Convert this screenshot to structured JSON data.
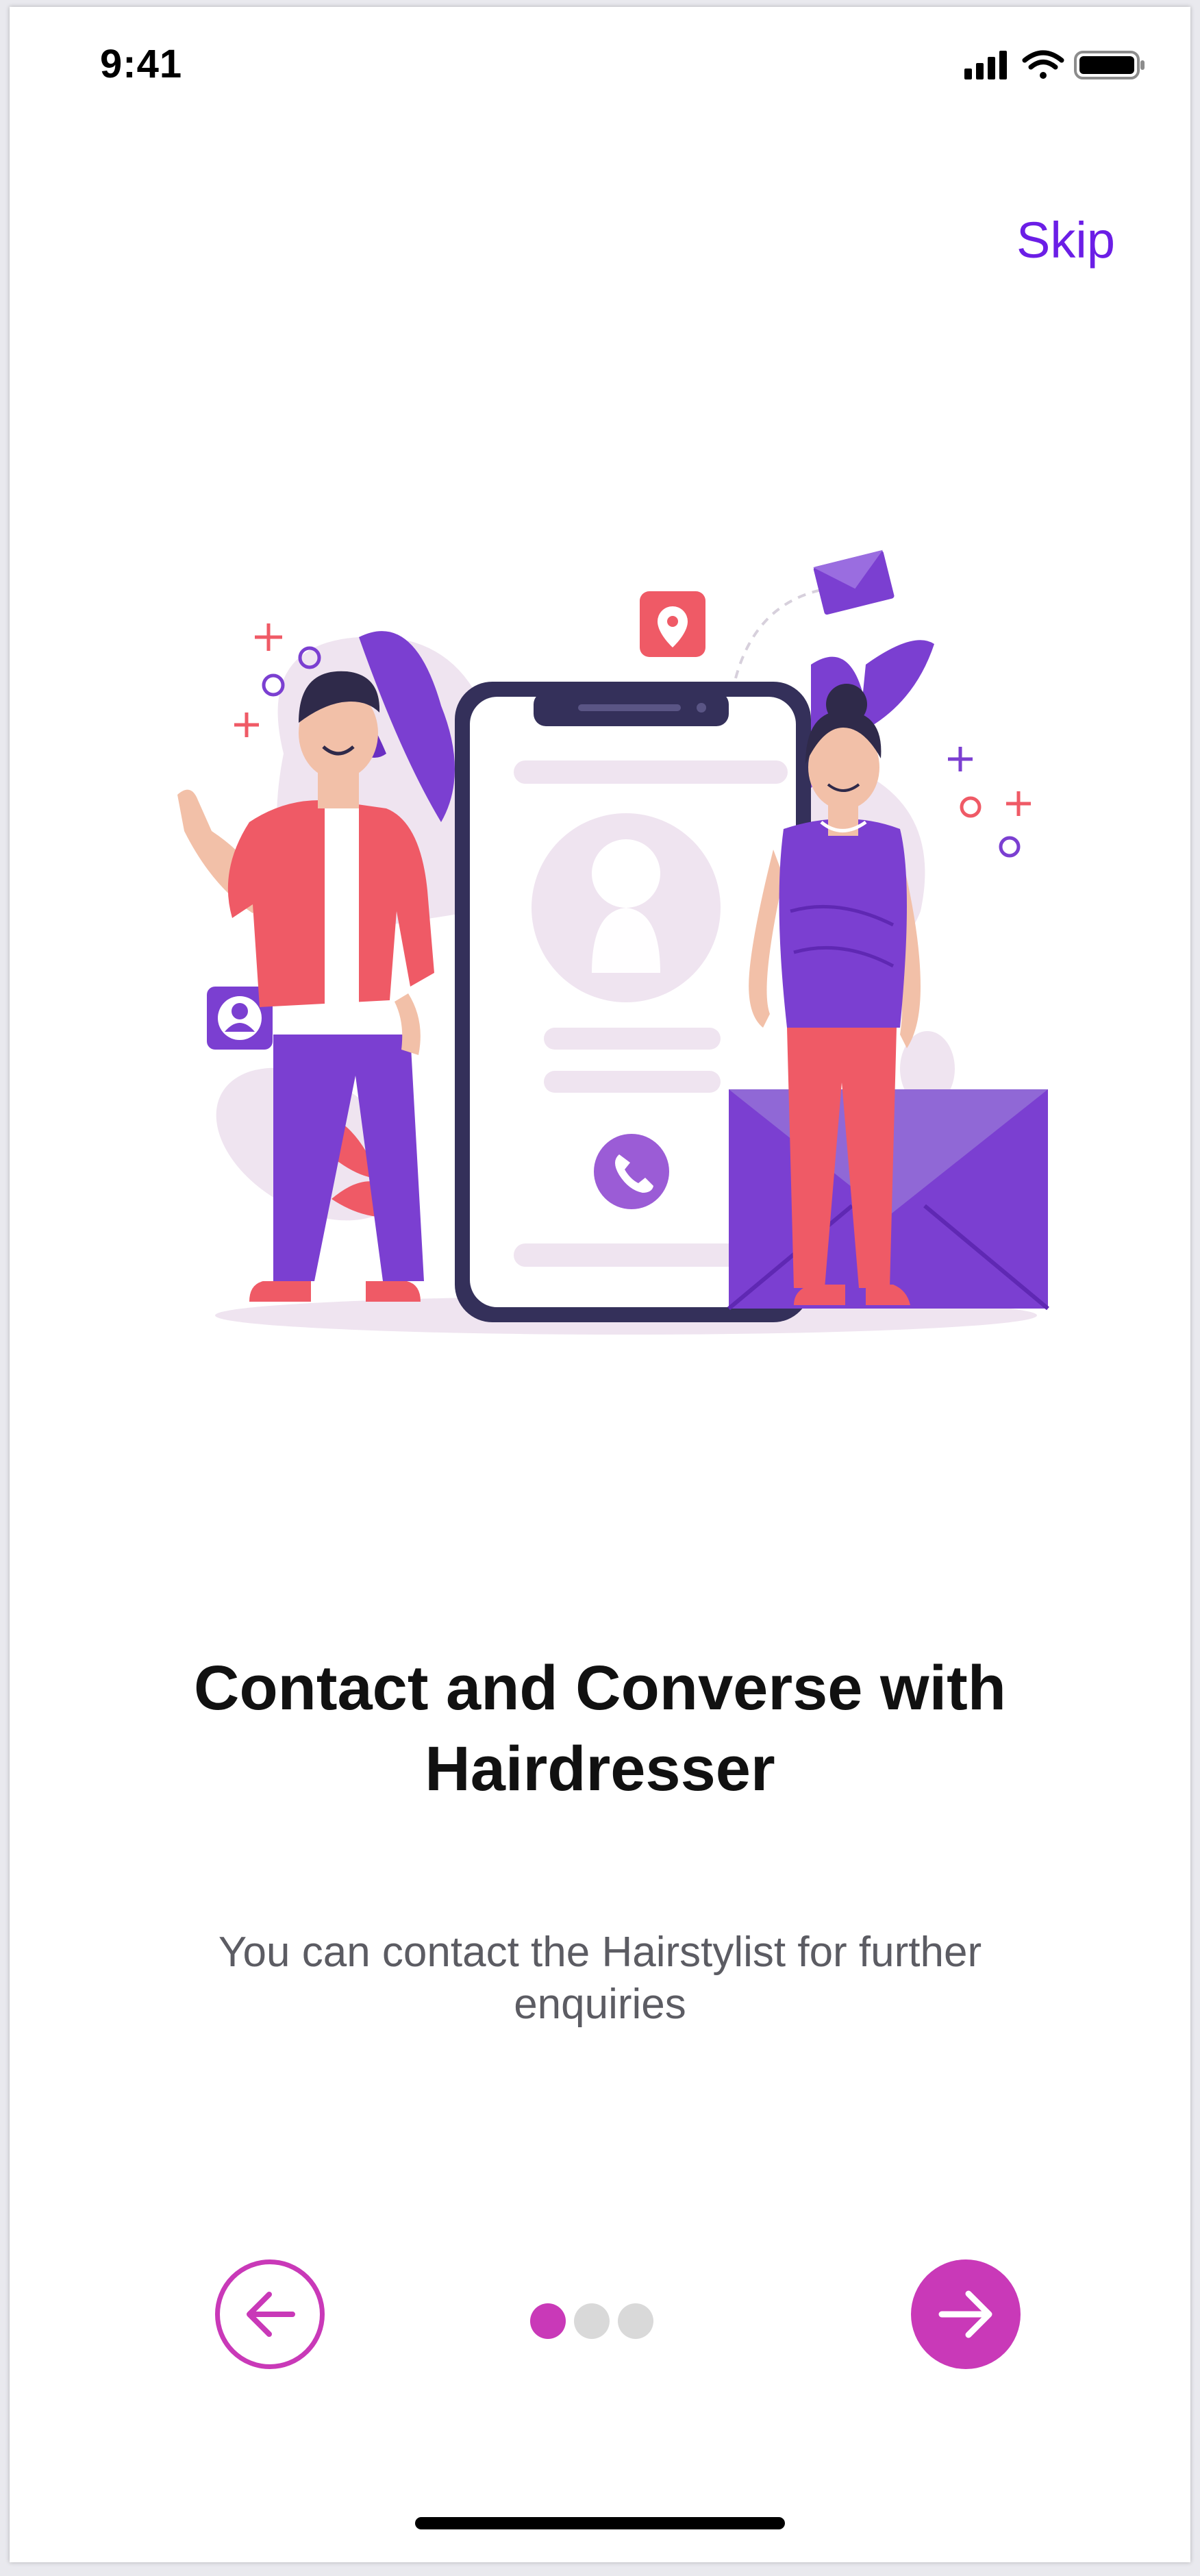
{
  "status_bar": {
    "time": "9:41",
    "icons": [
      "signal-icon",
      "wifi-icon",
      "battery-icon"
    ]
  },
  "header": {
    "skip_label": "Skip"
  },
  "onboarding": {
    "title": "Contact and Converse with Hairdresser",
    "subtitle": "You can contact the Hairstylist for further enquiries",
    "page_index": 1,
    "page_count": 3
  },
  "navigation": {
    "prev_icon": "arrow-left-icon",
    "next_icon": "arrow-right-icon"
  },
  "colors": {
    "accent": "#c939b8",
    "skip": "#6b1ee6",
    "purple": "#7b3fd1",
    "coral": "#ef5a66",
    "dot_inactive": "#d9d9d9"
  }
}
